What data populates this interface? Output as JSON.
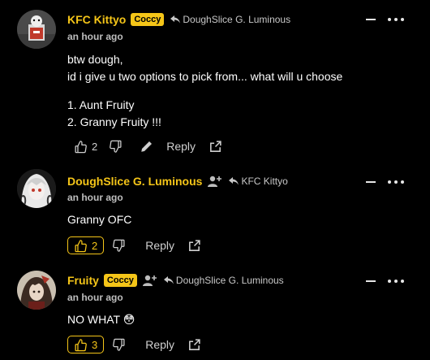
{
  "comments": [
    {
      "username": "KFC Kittyo",
      "badge": "Coccy",
      "reply_to": "DoughSlice G. Luminous",
      "time": "an hour ago",
      "body": [
        "btw dough,",
        "id i give u two options to pick from... what will u choose",
        "",
        "1. Aunt Fruity",
        "2. Granny Fruity !!!"
      ],
      "likes": "2",
      "reply_label": "Reply"
    },
    {
      "username": "DoughSlice G. Luminous",
      "reply_to": "KFC Kittyo",
      "time": "an hour ago",
      "body": [
        "Granny OFC"
      ],
      "likes": "2",
      "reply_label": "Reply"
    },
    {
      "username": "Fruity",
      "badge": "Coccy",
      "reply_to": "DoughSlice G. Luminous",
      "time": "an hour ago",
      "body": [
        "NO WHAT 😳"
      ],
      "likes": "3",
      "reply_label": "Reply"
    }
  ],
  "colors": {
    "accent": "#f5c518",
    "background": "#000000",
    "muted": "#bdbdbd"
  },
  "icons": [
    "thumbs-up-icon",
    "thumbs-down-icon",
    "pencil-icon",
    "share-icon",
    "reply-arrow-icon",
    "add-user-icon",
    "minus-icon",
    "more-icon"
  ]
}
